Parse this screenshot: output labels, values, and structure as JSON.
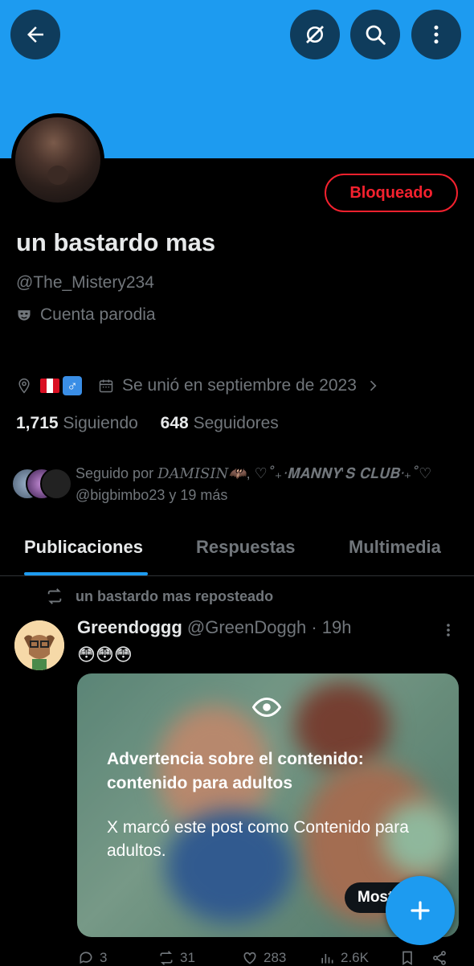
{
  "header": {
    "back_icon": "arrow-left-icon",
    "grok_icon": "grok-icon",
    "search_icon": "search-icon",
    "more_icon": "more-vertical-icon",
    "banner_color": "#1d9bf0"
  },
  "profile": {
    "display_name": "un bastardo mas",
    "handle": "@The_Mistery234",
    "label": "Cuenta parodia",
    "blocked_label": "Bloqueado",
    "joined": "Se unió en septiembre de 2023",
    "following_count": "1,715",
    "following_label": "Siguiendo",
    "followers_count": "648",
    "followers_label": "Seguidores"
  },
  "followed_by": {
    "prefix": "Seguido por ",
    "user1": "𝐷𝐴𝑀𝐼𝑆𝐼𝑁🦇",
    "sep": ", ",
    "user2": "♡˚₊‧𝐌𝐀𝐍𝐍𝐘'𝐒 𝐂𝐋𝐔𝐁‧₊˚♡",
    "line2": "@bigbimbo23 y 19 más"
  },
  "tabs": [
    {
      "label": "Publicaciones",
      "active": true
    },
    {
      "label": "Respuestas",
      "active": false
    },
    {
      "label": "Multimedia",
      "active": false
    }
  ],
  "post": {
    "repost_label": "un bastardo mas reposteado",
    "author_name": "Greendoggg",
    "author_handle": "@GreenDoggh",
    "time": " · 19h",
    "text": "😳😳😳",
    "warning_title": "Advertencia sobre el contenido: contenido para adultos",
    "warning_body": "X marcó este post como Contenido para adultos.",
    "show_label": "Mostrar",
    "replies": "3",
    "reposts": "31",
    "likes": "283",
    "views": "2.6K"
  },
  "fab": {
    "icon": "plus-icon",
    "color": "#1d9bf0"
  }
}
